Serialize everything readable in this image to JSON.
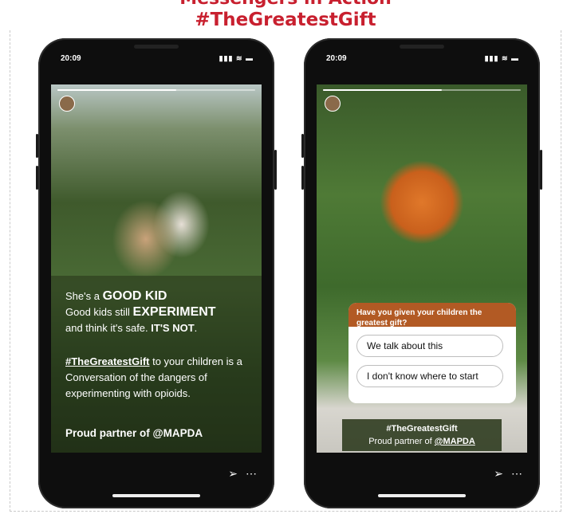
{
  "headline": {
    "line1": "Messengers in Action",
    "line2": "#TheGreatestGift"
  },
  "phones": [
    {
      "time": "20:09",
      "signal": "▮▮▮ ≋ ▬",
      "story": {
        "caption": {
          "l1a": "She's a ",
          "l1b": "GOOD KID",
          "l2a": "Good kids still ",
          "l2b": "EXPERIMENT",
          "l3a": "and think it's safe. ",
          "l3b": "IT'S NOT",
          "l3c": ".",
          "p2tag": "#TheGreatestGift",
          "p2rest": " to your children is a Conversation of the dangers of experimenting with opioids.",
          "partner": "Proud partner of @MAPDA"
        }
      }
    },
    {
      "time": "20:09",
      "signal": "▮▮▮ ≋ ▬",
      "story": {
        "poll_question": "Have you given your children the greatest gift?",
        "poll_options": [
          "We talk about this",
          "I don't know where to start"
        ],
        "tag": "#TheGreatestGift",
        "partner_a": "Proud partner of ",
        "partner_b": "@MAPDA"
      }
    }
  ],
  "icons": {
    "send": "send-icon",
    "more": "more-icon"
  }
}
